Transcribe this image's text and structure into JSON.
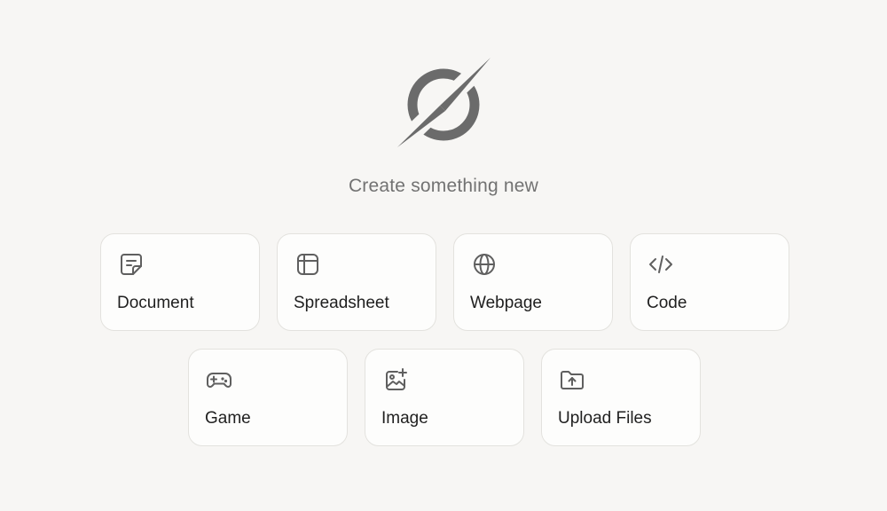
{
  "logo": {
    "icon": "compass-slash-logo-icon",
    "color": "#6b6b6b"
  },
  "subtitle": "Create something new",
  "cards": [
    {
      "label": "Document",
      "icon": "document-icon"
    },
    {
      "label": "Spreadsheet",
      "icon": "spreadsheet-icon"
    },
    {
      "label": "Webpage",
      "icon": "globe-icon"
    },
    {
      "label": "Code",
      "icon": "code-icon"
    },
    {
      "label": "Game",
      "icon": "gamepad-icon"
    },
    {
      "label": "Image",
      "icon": "image-sparkle-icon"
    },
    {
      "label": "Upload Files",
      "icon": "folder-upload-icon"
    }
  ],
  "colors": {
    "background": "#f7f6f4",
    "card": "#fdfdfc",
    "border": "#e3e2de",
    "text": "#1f1f1f",
    "muted": "#727272",
    "icon": "#5f5f5f"
  }
}
